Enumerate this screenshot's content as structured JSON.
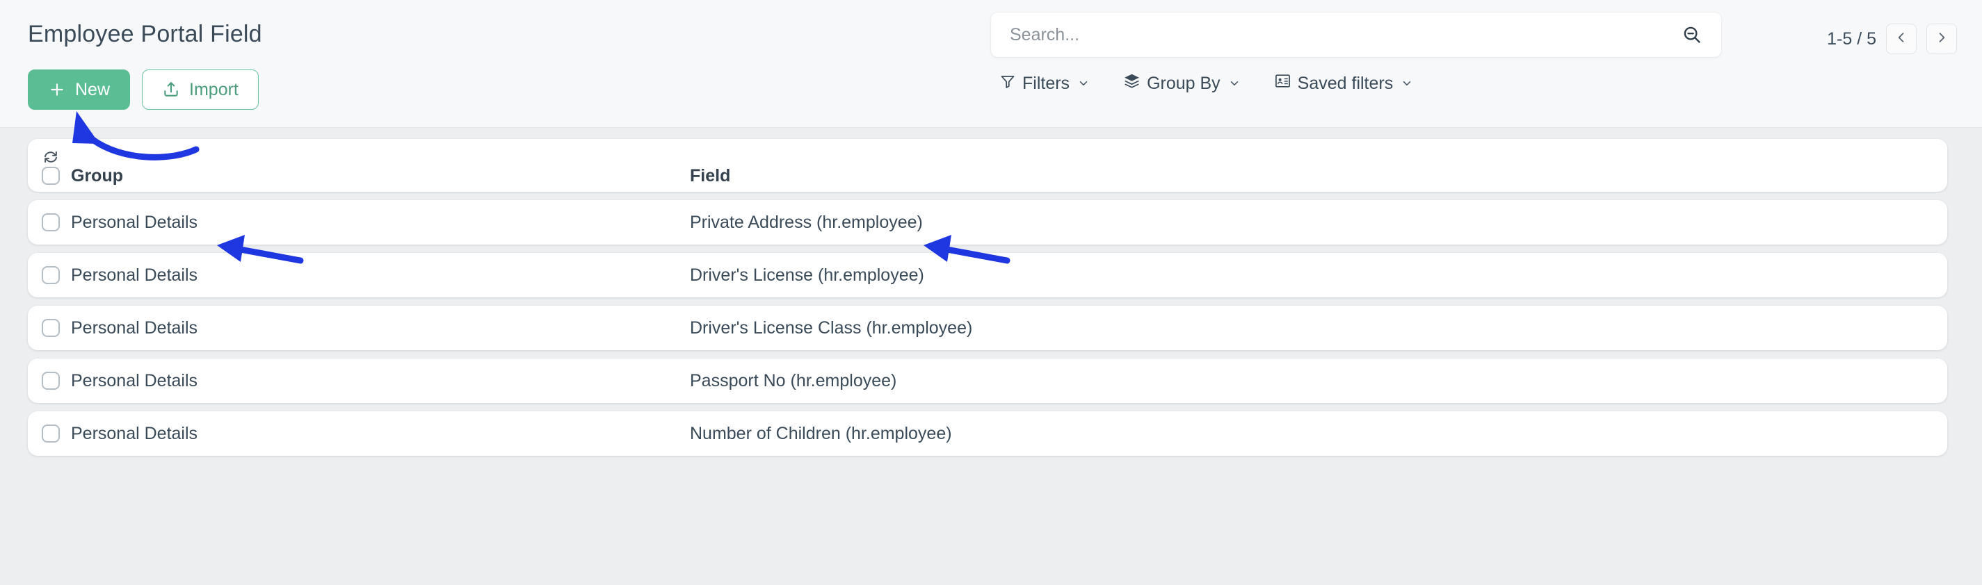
{
  "header": {
    "title": "Employee Portal Field",
    "buttons": [
      {
        "label": "New",
        "icon": "plus-icon",
        "style": "primary"
      },
      {
        "label": "Import",
        "icon": "upload-icon",
        "style": "outline"
      }
    ]
  },
  "search": {
    "value": "",
    "placeholder": "Search...",
    "icon": "search-minus-icon"
  },
  "filters": [
    {
      "label": "Filters",
      "icon": "funnel-icon"
    },
    {
      "label": "Group By",
      "icon": "layers-icon"
    },
    {
      "label": "Saved filters",
      "icon": "saved-card-icon"
    }
  ],
  "pager": {
    "count": "1-5 / 5",
    "prev_icon": "chevron-left-icon",
    "next_icon": "chevron-right-icon"
  },
  "table": {
    "sync_icon": "refresh-icon",
    "columns": [
      {
        "key": "group",
        "label": "Group"
      },
      {
        "key": "field",
        "label": "Field"
      }
    ],
    "rows": [
      {
        "group": "Personal Details",
        "field": "Private Address (hr.employee)"
      },
      {
        "group": "Personal Details",
        "field": "Driver's License (hr.employee)"
      },
      {
        "group": "Personal Details",
        "field": "Driver's License Class (hr.employee)"
      },
      {
        "group": "Personal Details",
        "field": "Passport No (hr.employee)"
      },
      {
        "group": "Personal Details",
        "field": "Number of Children (hr.employee)"
      }
    ]
  },
  "annotations": [
    {
      "name": "arrow-to-new-button",
      "shape": "curved-arrow",
      "color": "#1f37e0"
    },
    {
      "name": "arrow-to-group-cell",
      "shape": "straight-arrow",
      "color": "#1f37e0"
    },
    {
      "name": "arrow-to-field-cell",
      "shape": "straight-arrow",
      "color": "#1f37e0"
    }
  ],
  "colors": {
    "accent_green": "#5bbd93",
    "text_dark": "#3a4a58",
    "page_bg": "#f7f8f9",
    "list_bg": "#eceef0",
    "annotation_blue": "#1f37e0"
  }
}
